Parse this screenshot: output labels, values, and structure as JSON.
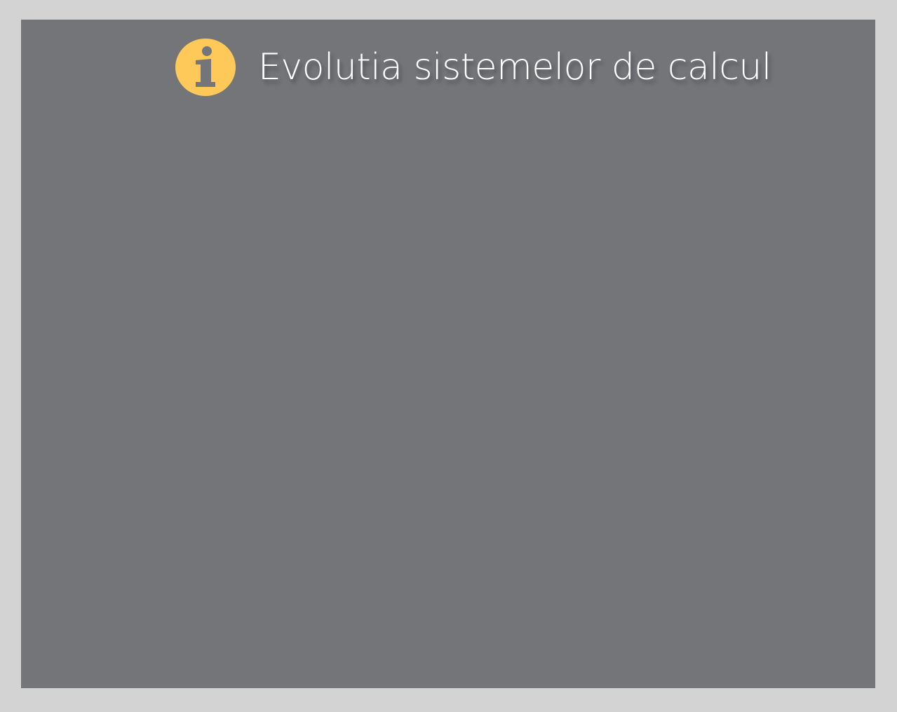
{
  "slide": {
    "title": "Evolutia sistemelor de calcul",
    "icon": "info-icon"
  },
  "colors": {
    "page_background": "#d3d3d3",
    "slide_background": "#747579",
    "icon_fill": "#ffc95a",
    "icon_glyph": "#747579",
    "title_text": "#ffffff"
  }
}
